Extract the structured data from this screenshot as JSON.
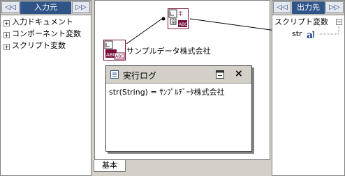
{
  "input_panel": {
    "prev_btn": "◁◁",
    "title": "入力元",
    "next_btn": "▷▷",
    "items": [
      {
        "expander": "+",
        "label": "入力ドキュメント"
      },
      {
        "expander": "+",
        "label": "コンポーネント変数"
      },
      {
        "expander": "+",
        "label": "スクリプト変数"
      }
    ]
  },
  "output_panel": {
    "prev_btn": "◁◁",
    "title": "出力先",
    "next_btn": "▷▷",
    "root_label": "スクリプト変数",
    "root_expander": "−",
    "child_label": "str"
  },
  "canvas": {
    "component_label": "サンプルデータ株式会社",
    "tab_label": "基本"
  },
  "log_window": {
    "title": "実行ログ",
    "close_btn": "×",
    "text": "str(String) = ｻﾝﾌﾟﾙﾃﾞｰﾀ株式会社"
  }
}
